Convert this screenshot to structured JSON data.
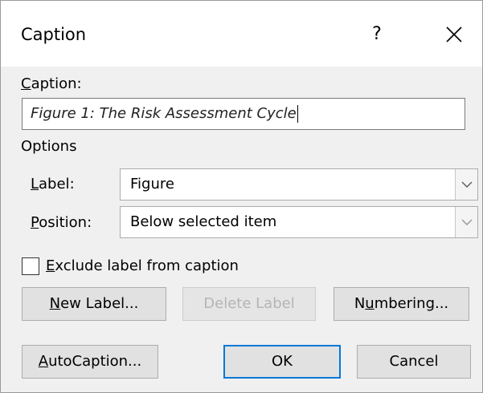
{
  "dialog": {
    "title": "Caption",
    "help_glyph": "?",
    "close_icon": "close-icon"
  },
  "caption": {
    "label_accel": "C",
    "label_rest": "aption:",
    "value": "Figure 1: The Risk Assessment Cycle"
  },
  "options": {
    "heading": "Options",
    "label_field": {
      "label_accel": "L",
      "label_rest": "abel:",
      "value": "Figure"
    },
    "position_field": {
      "label_accel": "P",
      "label_rest": "osition:",
      "value": "Below selected item"
    }
  },
  "exclude_label": {
    "checked": false,
    "label_accel": "E",
    "label_rest": "xclude label from caption"
  },
  "buttons": {
    "new_label": {
      "accel": "N",
      "rest": "ew Label..."
    },
    "delete_label": {
      "text": "Delete Label",
      "enabled": false
    },
    "numbering": {
      "pre": "N",
      "accel": "u",
      "rest": "mbering..."
    },
    "autocaption": {
      "accel": "A",
      "rest": "utoCaption..."
    },
    "ok": "OK",
    "cancel": "Cancel"
  },
  "colors": {
    "default_button_border": "#0078d7",
    "dialog_background": "#f0f0f0",
    "disabled_text": "#b5b5b5"
  }
}
